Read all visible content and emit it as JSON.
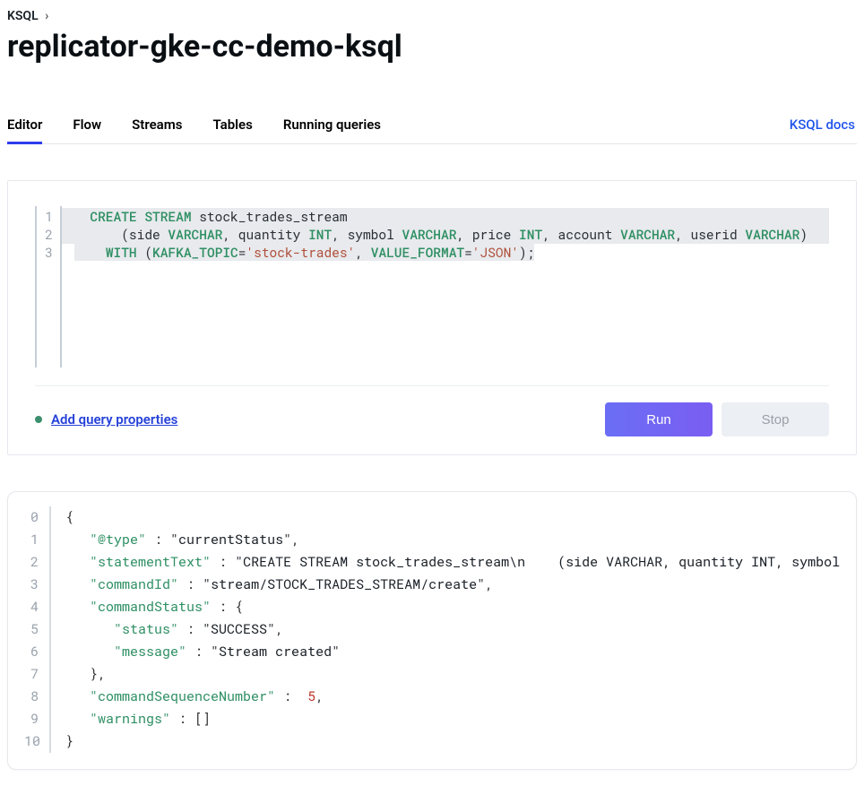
{
  "breadcrumb": {
    "parent": "KSQL"
  },
  "page_title": "replicator-gke-cc-demo-ksql",
  "tabs": [
    {
      "label": "Editor",
      "active": true
    },
    {
      "label": "Flow"
    },
    {
      "label": "Streams"
    },
    {
      "label": "Tables"
    },
    {
      "label": "Running queries"
    }
  ],
  "docs_link_label": "KSQL docs",
  "editor": {
    "line_numbers": [
      "1",
      "2",
      "3"
    ],
    "lines": [
      [
        {
          "t": "  ",
          "c": ""
        },
        {
          "t": "CREATE STREAM",
          "c": "kw"
        },
        {
          "t": " stock_trades_stream",
          "c": "idn"
        }
      ],
      [
        {
          "t": "      (side ",
          "c": "idn"
        },
        {
          "t": "VARCHAR",
          "c": "ty"
        },
        {
          "t": ", quantity ",
          "c": "idn"
        },
        {
          "t": "INT",
          "c": "ty"
        },
        {
          "t": ", symbol ",
          "c": "idn"
        },
        {
          "t": "VARCHAR",
          "c": "ty"
        },
        {
          "t": ", price ",
          "c": "idn"
        },
        {
          "t": "INT",
          "c": "ty"
        },
        {
          "t": ", account ",
          "c": "idn"
        },
        {
          "t": "VARCHAR",
          "c": "ty"
        },
        {
          "t": ", userid ",
          "c": "idn"
        },
        {
          "t": "VARCHAR",
          "c": "ty"
        },
        {
          "t": ")",
          "c": "idn"
        }
      ],
      [
        {
          "t": "    ",
          "c": ""
        },
        {
          "t": "WITH",
          "c": "kw"
        },
        {
          "t": " (",
          "c": "idn"
        },
        {
          "t": "KAFKA_TOPIC",
          "c": "ty"
        },
        {
          "t": "=",
          "c": "idn"
        },
        {
          "t": "'stock-trades'",
          "c": "str"
        },
        {
          "t": ", ",
          "c": "idn"
        },
        {
          "t": "VALUE_FORMAT",
          "c": "ty"
        },
        {
          "t": "=",
          "c": "idn"
        },
        {
          "t": "'JSON'",
          "c": "str"
        },
        {
          "t": ");",
          "c": "idn"
        }
      ]
    ],
    "highlight_lines": [
      0,
      1
    ],
    "highlight_partial_end": 2
  },
  "actions": {
    "add_properties_label": "Add query properties",
    "run_label": "Run",
    "stop_label": "Stop"
  },
  "output": {
    "line_numbers": [
      "0",
      "1",
      "2",
      "3",
      "4",
      "5",
      "6",
      "7",
      "8",
      "9",
      "10"
    ],
    "lines": [
      [
        {
          "t": "{",
          "c": "jpunct"
        }
      ],
      [
        {
          "t": "   ",
          "c": ""
        },
        {
          "t": "\"@type\"",
          "c": "jkey"
        },
        {
          "t": " : ",
          "c": "jpunct"
        },
        {
          "t": "\"currentStatus\"",
          "c": "jstr"
        },
        {
          "t": ",",
          "c": "jpunct"
        }
      ],
      [
        {
          "t": "   ",
          "c": ""
        },
        {
          "t": "\"statementText\"",
          "c": "jkey"
        },
        {
          "t": " : ",
          "c": "jpunct"
        },
        {
          "t": "\"CREATE STREAM stock_trades_stream\\n    (side VARCHAR, quantity INT, symbol VARCHAR,",
          "c": "jstr"
        }
      ],
      [
        {
          "t": "   ",
          "c": ""
        },
        {
          "t": "\"commandId\"",
          "c": "jkey"
        },
        {
          "t": " : ",
          "c": "jpunct"
        },
        {
          "t": "\"stream/STOCK_TRADES_STREAM/create\"",
          "c": "jstr"
        },
        {
          "t": ",",
          "c": "jpunct"
        }
      ],
      [
        {
          "t": "   ",
          "c": ""
        },
        {
          "t": "\"commandStatus\"",
          "c": "jkey"
        },
        {
          "t": " : {",
          "c": "jpunct"
        }
      ],
      [
        {
          "t": "      ",
          "c": ""
        },
        {
          "t": "\"status\"",
          "c": "jkey"
        },
        {
          "t": " : ",
          "c": "jpunct"
        },
        {
          "t": "\"SUCCESS\"",
          "c": "jstr"
        },
        {
          "t": ",",
          "c": "jpunct"
        }
      ],
      [
        {
          "t": "      ",
          "c": ""
        },
        {
          "t": "\"message\"",
          "c": "jkey"
        },
        {
          "t": " : ",
          "c": "jpunct"
        },
        {
          "t": "\"Stream created\"",
          "c": "jstr"
        }
      ],
      [
        {
          "t": "   },",
          "c": "jpunct"
        }
      ],
      [
        {
          "t": "   ",
          "c": ""
        },
        {
          "t": "\"commandSequenceNumber\"",
          "c": "jkey"
        },
        {
          "t": " : ",
          "c": "jpunct"
        },
        {
          "t": " 5",
          "c": "jnum"
        },
        {
          "t": ",",
          "c": "jpunct"
        }
      ],
      [
        {
          "t": "   ",
          "c": ""
        },
        {
          "t": "\"warnings\"",
          "c": "jkey"
        },
        {
          "t": " : []",
          "c": "jpunct"
        }
      ],
      [
        {
          "t": "}",
          "c": "jpunct"
        }
      ]
    ]
  }
}
